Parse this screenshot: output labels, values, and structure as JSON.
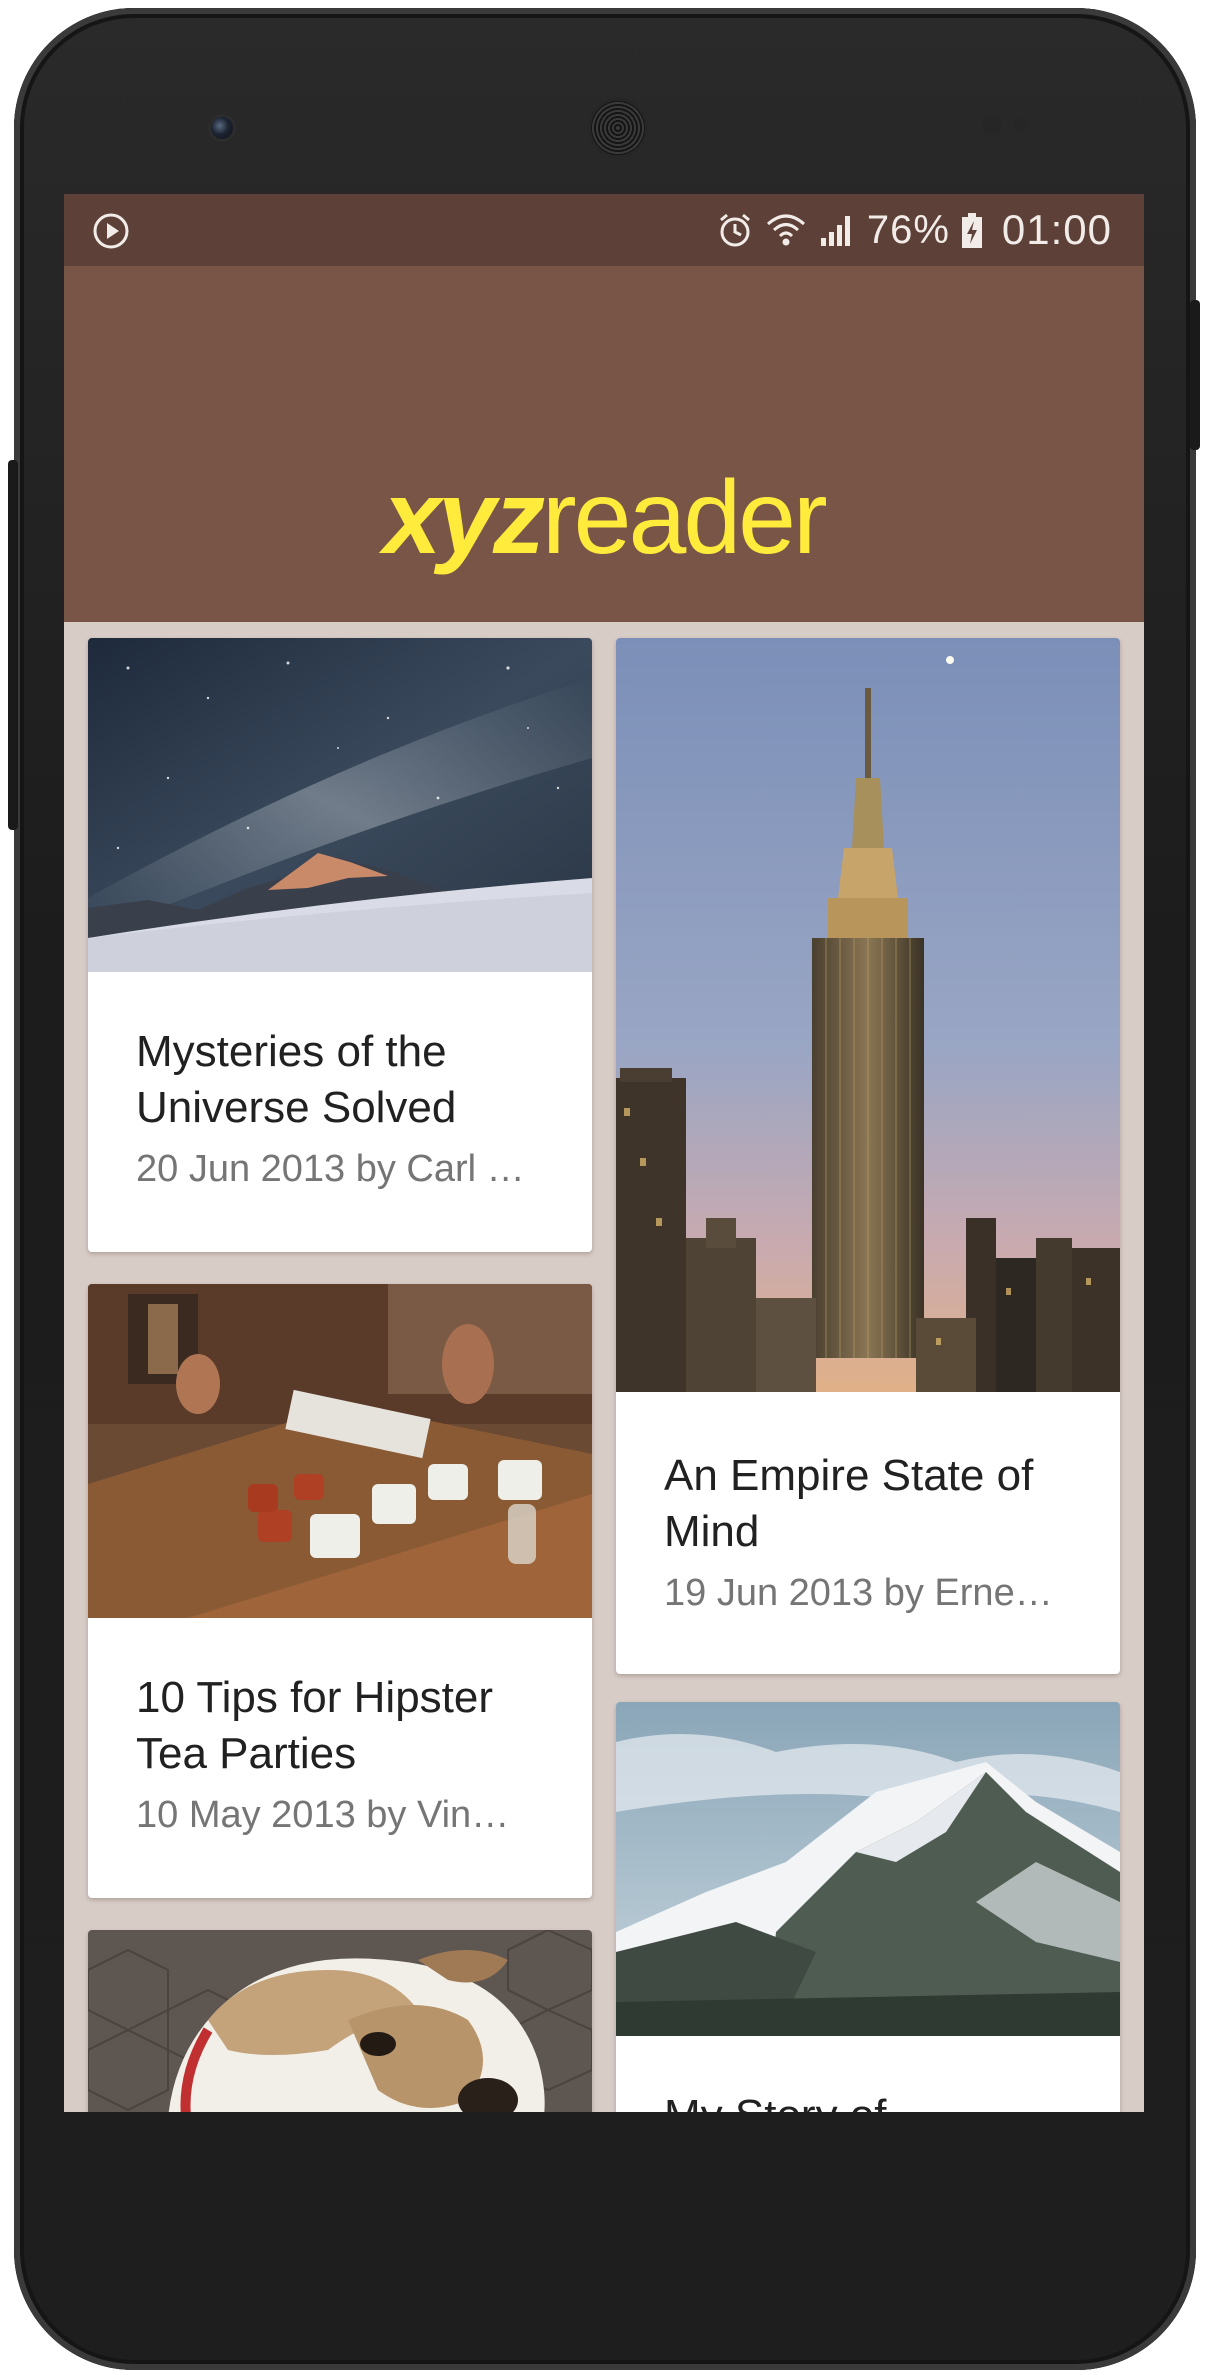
{
  "status_bar": {
    "battery_percent": "76%",
    "time": "01:00",
    "icons": [
      "play-icon",
      "alarm-icon",
      "wifi-icon",
      "signal-icon",
      "battery-charging-icon"
    ]
  },
  "app": {
    "logo_bold": "xyz",
    "logo_light": "reader",
    "toolbar_color": "#795548",
    "status_color": "#5d4037",
    "accent": "#ffeb3b"
  },
  "articles": [
    {
      "title": "Mysteries of the Universe Solved",
      "meta": "20 Jun 2013 by Carl …",
      "image": "night-sky-mountain"
    },
    {
      "title": "An Empire State of Mind",
      "meta": "19 Jun 2013 by Erne…",
      "image": "empire-state-building"
    },
    {
      "title": "10 Tips for Hipster Tea Parties",
      "meta": "10 May 2013 by Vin…",
      "image": "tea-party-table"
    },
    {
      "title": "My Story of",
      "meta": "",
      "image": "snowy-mountain"
    },
    {
      "title": "",
      "meta": "",
      "image": "bulldog"
    }
  ]
}
